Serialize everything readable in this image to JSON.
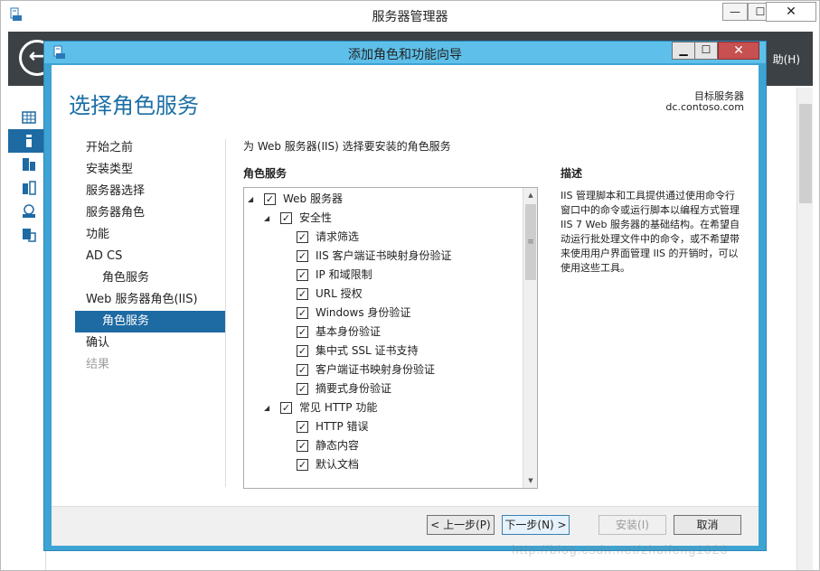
{
  "outer_window": {
    "title": "服务器管理器",
    "help_menu": "助(H)",
    "min_label": "—",
    "max_label": "☐",
    "close_label": "✕"
  },
  "dialog": {
    "title": "添加角色和功能向导",
    "min_label": "▁",
    "max_label": "☐",
    "close_label": "✕",
    "page_title": "选择角色服务",
    "target_label": "目标服务器",
    "target_value": "dc.contoso.com",
    "intro": "为 Web 服务器(IIS) 选择要安装的角色服务",
    "role_services_heading": "角色服务",
    "description_heading": "描述",
    "description_text": "IIS 管理脚本和工具提供通过使用命令行窗口中的命令或运行脚本以编程方式管理 IIS 7 Web 服务器的基础结构。在希望自动运行批处理文件中的命令，或不希望带来使用用户界面管理 IIS 的开销时，可以使用这些工具。"
  },
  "steps": [
    {
      "label": "开始之前"
    },
    {
      "label": "安装类型"
    },
    {
      "label": "服务器选择"
    },
    {
      "label": "服务器角色"
    },
    {
      "label": "功能"
    },
    {
      "label": "AD CS"
    },
    {
      "label": "角色服务"
    },
    {
      "label": "Web 服务器角色(IIS)"
    },
    {
      "label": "角色服务"
    },
    {
      "label": "确认"
    },
    {
      "label": "结果"
    }
  ],
  "tree": [
    {
      "label": "Web 服务器",
      "checked": true,
      "expanded": true
    },
    {
      "label": "安全性",
      "checked": true,
      "expanded": true
    },
    {
      "label": "请求筛选",
      "checked": true
    },
    {
      "label": "IIS 客户端证书映射身份验证",
      "checked": true
    },
    {
      "label": "IP 和域限制",
      "checked": true
    },
    {
      "label": "URL 授权",
      "checked": true
    },
    {
      "label": "Windows 身份验证",
      "checked": true
    },
    {
      "label": "基本身份验证",
      "checked": true
    },
    {
      "label": "集中式 SSL 证书支持",
      "checked": true
    },
    {
      "label": "客户端证书映射身份验证",
      "checked": true
    },
    {
      "label": "摘要式身份验证",
      "checked": true
    },
    {
      "label": "常见 HTTP 功能",
      "checked": true,
      "expanded": true
    },
    {
      "label": "HTTP 错误",
      "checked": true
    },
    {
      "label": "静态内容",
      "checked": true
    },
    {
      "label": "默认文档",
      "checked": true
    }
  ],
  "buttons": {
    "previous": "< 上一步(P)",
    "next": "下一步(N) >",
    "install": "安装(I)",
    "cancel": "取消"
  },
  "watermark": "http://blog.csdn.net/zhuifeng1023",
  "icons": {
    "check": "✓",
    "expanded": "◢",
    "back": "←",
    "scroll_up": "▲",
    "scroll_down": "▼",
    "grip": "≡"
  },
  "colors": {
    "dialog_frame": "#3da3d3",
    "dialog_title_bar": "#5ec0ea",
    "accent": "#1e6aa3",
    "title_text": "#1b6ea5",
    "close_button": "#c75050"
  }
}
